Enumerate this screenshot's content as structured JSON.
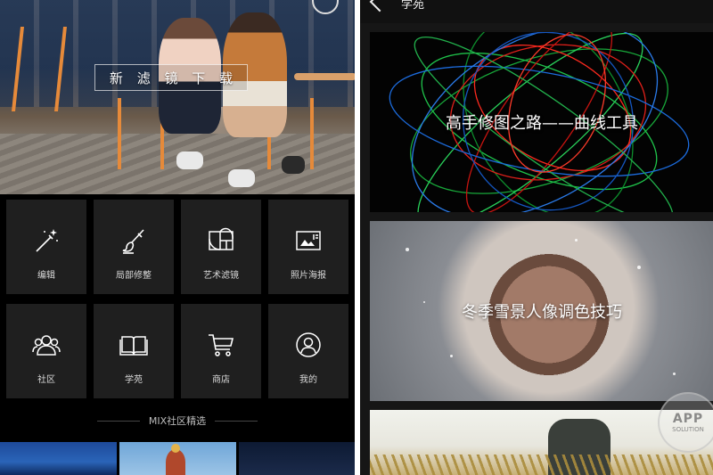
{
  "left_screen": {
    "banner": {
      "chars": [
        "新",
        "滤",
        "镜",
        "下",
        "载"
      ]
    },
    "tools": [
      {
        "label": "编辑",
        "icon": "magic-wand-icon"
      },
      {
        "label": "局部修整",
        "icon": "brush-icon"
      },
      {
        "label": "艺术滤镜",
        "icon": "golden-ratio-frame-icon"
      },
      {
        "label": "照片海报",
        "icon": "photo-poster-icon"
      },
      {
        "label": "社区",
        "icon": "community-people-icon"
      },
      {
        "label": "学苑",
        "icon": "open-book-icon"
      },
      {
        "label": "商店",
        "icon": "shopping-cart-icon"
      },
      {
        "label": "我的",
        "icon": "user-profile-icon"
      }
    ],
    "section_title": "MIX社区精选"
  },
  "right_screen": {
    "header": {
      "title": "学苑"
    },
    "cards": [
      {
        "title": "高手修图之路——曲线工具"
      },
      {
        "title": "冬季雪景人像调色技巧"
      },
      {
        "title": ""
      }
    ]
  },
  "watermark": {
    "line1": "APP",
    "line2": "SOLUTION"
  },
  "colors": {
    "background": "#000000",
    "tile": "#1f1f1f",
    "tile_label": "#d8d8d8",
    "banner_border": "#ffffff",
    "right_bg": "#161616"
  }
}
